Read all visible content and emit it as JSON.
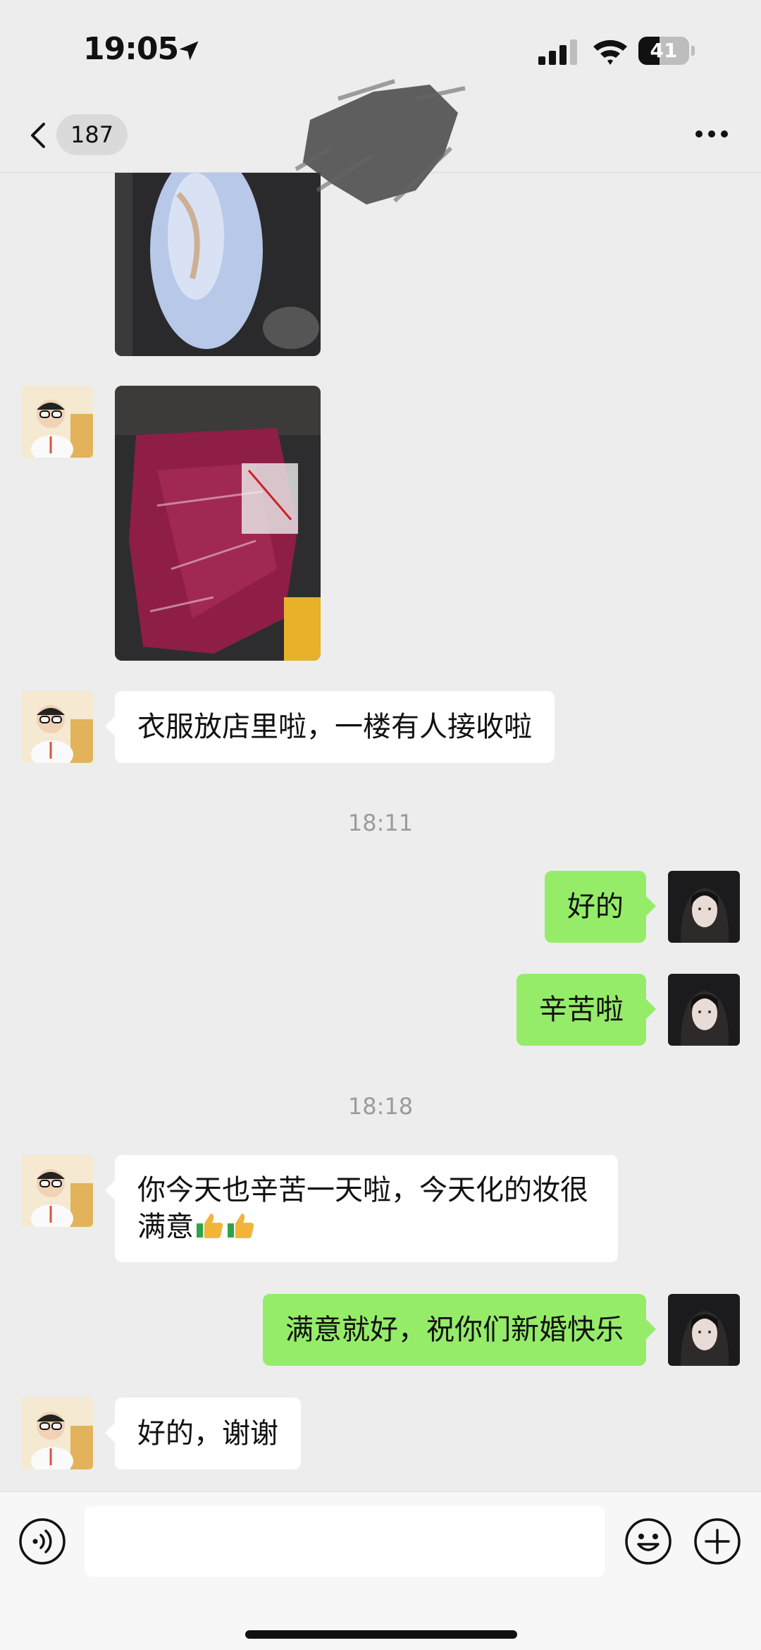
{
  "status_bar": {
    "time": "19:05",
    "battery": "41",
    "battery_level_percent": 41,
    "icons": [
      "location-arrow-icon",
      "cellular-signal-icon",
      "wifi-icon",
      "battery-icon"
    ]
  },
  "nav": {
    "back_icon": "chevron-left-icon",
    "unread_count": "187",
    "more_icon": "ellipsis-icon"
  },
  "messages": [
    {
      "type": "image",
      "side": "in",
      "description": "photo-bags-blue"
    },
    {
      "type": "image",
      "side": "in",
      "description": "photo-bags-red"
    },
    {
      "type": "text",
      "side": "in",
      "text": "衣服放店里啦，一楼有人接收啦"
    },
    {
      "type": "time",
      "text": "18:11"
    },
    {
      "type": "text",
      "side": "out",
      "text": "好的"
    },
    {
      "type": "text",
      "side": "out",
      "text": "辛苦啦"
    },
    {
      "type": "time",
      "text": "18:18"
    },
    {
      "type": "text",
      "side": "in",
      "text": "你今天也辛苦一天啦，今天化的妆很满意",
      "emoji": "thumbs-up-icon ×2"
    },
    {
      "type": "text",
      "side": "out",
      "text": "满意就好，祝你们新婚快乐"
    },
    {
      "type": "text",
      "side": "in",
      "text": "好的，谢谢"
    }
  ],
  "input_bar": {
    "input_value": "",
    "icons": [
      "voice-icon",
      "emoji-icon",
      "plus-icon"
    ]
  },
  "colors": {
    "background": "#ededed",
    "incoming_bubble": "#ffffff",
    "outgoing_bubble": "#95ec69",
    "timestamp": "#9b9b9b"
  }
}
